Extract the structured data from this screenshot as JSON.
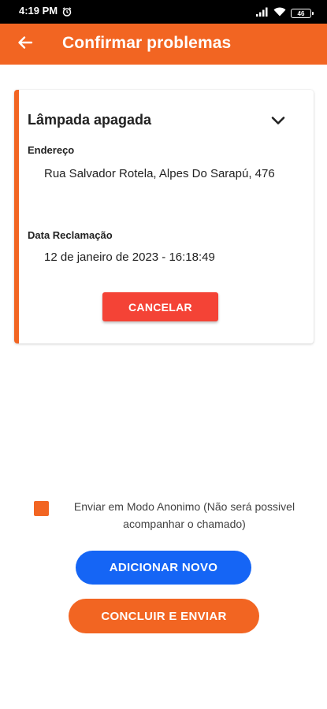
{
  "status_bar": {
    "time": "4:19 PM",
    "battery": "46",
    "icons": [
      "alarm-clock-icon",
      "signal-icon",
      "wifi-icon",
      "battery-icon"
    ]
  },
  "app_bar": {
    "title": "Confirmar problemas",
    "back_icon": "arrow-left-icon",
    "color": "#F26522"
  },
  "problem_card": {
    "title": "Lâmpada apagada",
    "address_label": "Endereço",
    "address_value": "Rua Salvador Rotela, Alpes Do Sarapú, 476",
    "date_label": "Data Reclamação",
    "date_value": "12 de janeiro de 2023 - 16:18:49",
    "cancel_label": "CANCELAR",
    "expand_icon": "chevron-down-icon"
  },
  "anonymous": {
    "label": "Enviar em Modo Anonimo (Não será possivel acompanhar o chamado)",
    "checked": true
  },
  "actions": {
    "add_label": "ADICIONAR NOVO",
    "submit_label": "CONCLUIR E ENVIAR"
  },
  "colors": {
    "primary": "#F26522",
    "cancel": "#F44336",
    "add": "#1565F5"
  }
}
